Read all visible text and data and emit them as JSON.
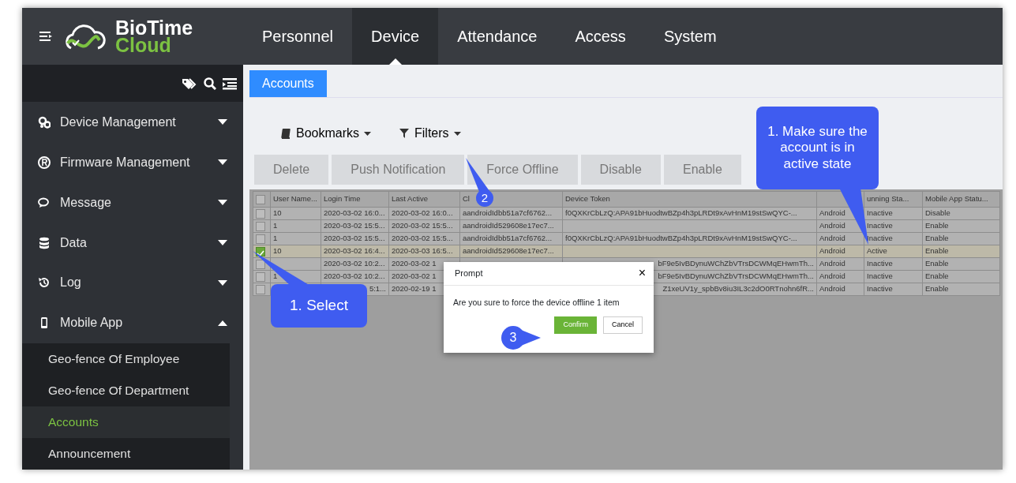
{
  "header": {
    "logo_text": "BioTime",
    "logo_subtext": "Cloud",
    "nav": [
      {
        "label": "Personnel",
        "selected": false
      },
      {
        "label": "Device",
        "selected": true
      },
      {
        "label": "Attendance",
        "selected": false
      },
      {
        "label": "Access",
        "selected": false
      },
      {
        "label": "System",
        "selected": false
      }
    ]
  },
  "sidebar": {
    "items": [
      {
        "label": "Device Management",
        "expanded": false
      },
      {
        "label": "Firmware Management",
        "expanded": false
      },
      {
        "label": "Message",
        "expanded": false
      },
      {
        "label": "Data",
        "expanded": false
      },
      {
        "label": "Log",
        "expanded": false
      },
      {
        "label": "Mobile App",
        "expanded": true,
        "children": [
          {
            "label": "Geo-fence Of Employee",
            "selected": false
          },
          {
            "label": "Geo-fence Of Department",
            "selected": false
          },
          {
            "label": "Accounts",
            "selected": true
          },
          {
            "label": "Announcement",
            "selected": false
          }
        ]
      }
    ]
  },
  "tab": {
    "label": "Accounts"
  },
  "toolbar": {
    "dropdowns": [
      "Bookmarks",
      "Filters"
    ],
    "buttons": [
      "Delete",
      "Push Notification",
      "Force Offline",
      "Disable",
      "Enable"
    ]
  },
  "table": {
    "all_checked": false,
    "columns": [
      "User Name...",
      "Login Time",
      "Last Active",
      "Cl",
      "Device Token",
      null,
      "unning Sta...",
      "Mobile App Statu..."
    ],
    "rows": [
      {
        "checked": false,
        "cells": [
          "10",
          "2020-03-02 16:0...",
          "2020-03-02 16:0...",
          "aandroidIdbb51a7cf6762...",
          "f0QXKrCbLzQ:APA91bHuodtwBZp4h3pLRDt9xAvHnM19stSwQYC-...",
          "Android",
          "Inactive",
          "Disable"
        ]
      },
      {
        "checked": false,
        "cells": [
          "1",
          "2020-03-02 15:5...",
          "2020-03-02 15:5...",
          "aandroidId529608e17ec7...",
          null,
          "Android",
          "Inactive",
          "Enable"
        ]
      },
      {
        "checked": false,
        "cells": [
          "1",
          "2020-03-02 15:5...",
          "2020-03-02 15:5...",
          "aandroidIdbb51a7cf6762...",
          "f0QXKrCbLzQ:APA91bHuodtwBZp4h3pLRDt9xAvHnM19stSwQYC-...",
          "Android",
          "Inactive",
          "Enable"
        ]
      },
      {
        "checked": true,
        "cells": [
          "10",
          "2020-03-02 16:4...",
          "2020-03-03 16:5...",
          "aandroidId529608e17ec7...",
          null,
          "Android",
          "Active",
          "Enable"
        ]
      },
      {
        "checked": false,
        "cells": [
          null,
          "2020-03-02 10:2...",
          "2020-03-02 1",
          null,
          {
            "text": "bF9e5IvBDynuWChZbVTrsDCWMqEHwmTh...",
            "kind": "tail"
          },
          "Android",
          "Inactive",
          "Enable"
        ]
      },
      {
        "checked": false,
        "cells": [
          "1",
          "2020-03-02 10:2...",
          "2020-03-02 1",
          null,
          {
            "text": "bF9e5IvBDynuWChZbVTrsDCWMqEHwmTh...",
            "kind": "tail"
          },
          "Android",
          "Inactive",
          "Enable"
        ]
      },
      {
        "checked": false,
        "cells": [
          null,
          {
            "text": "5:1...",
            "kind": "tail"
          },
          "2020-02-19 1",
          null,
          {
            "text": "Z1xeUV1y_spbBv8iu3IL3c2dO0RTnohn6fR...",
            "kind": "tail"
          },
          "Android",
          "Inactive",
          "Enable"
        ]
      }
    ]
  },
  "dialog": {
    "title": "Prompt",
    "close": "×",
    "message": "Are you sure to force the device offline 1 item",
    "buttons": [
      {
        "label": "Confirm",
        "kind": "primary"
      },
      {
        "label": "Cancel",
        "kind": "secondary"
      }
    ]
  },
  "callouts": [
    {
      "kind": "bubble",
      "text": "1. Make sure the account is in active state"
    },
    {
      "kind": "circle",
      "text": "2"
    },
    {
      "kind": "bubble",
      "text": "1. Select"
    },
    {
      "kind": "circle",
      "text": "3"
    }
  ]
}
